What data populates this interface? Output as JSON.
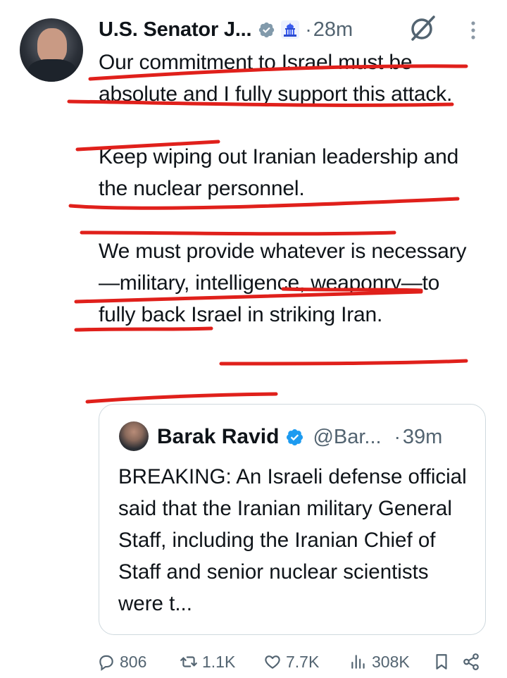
{
  "tweet": {
    "display_name": "U.S. Senator J...",
    "time": "28m",
    "separator": "·",
    "paragraphs": [
      "Our commitment to Israel must be absolute and I fully support this attack.",
      "Keep wiping out Iranian leadership and the nuclear personnel.",
      "We must provide whatever is necessary—military, intelligence, weaponry—to fully back Israel in striking Iran."
    ]
  },
  "quoted_tweet": {
    "display_name": "Barak Ravid",
    "handle": "@Bar...",
    "separator": "·",
    "time": "39m",
    "text": "BREAKING: An Israeli defense official said that the Iranian military General Staff, including the Iranian Chief of Staff and senior nuclear scientists were t..."
  },
  "actions": {
    "replies": "806",
    "reposts": "1.1K",
    "likes": "7.7K",
    "views": "308K"
  },
  "colors": {
    "text": "#0f1419",
    "secondary": "#536471",
    "verified": "#1d9bf0",
    "annotation_red": "#e0201b",
    "border": "#cfd9de"
  },
  "icons": [
    "verified-badge-icon",
    "government-building-icon",
    "grok-icon",
    "more-options-icon",
    "reply-icon",
    "repost-icon",
    "like-icon",
    "views-icon",
    "bookmark-icon",
    "share-icon"
  ]
}
